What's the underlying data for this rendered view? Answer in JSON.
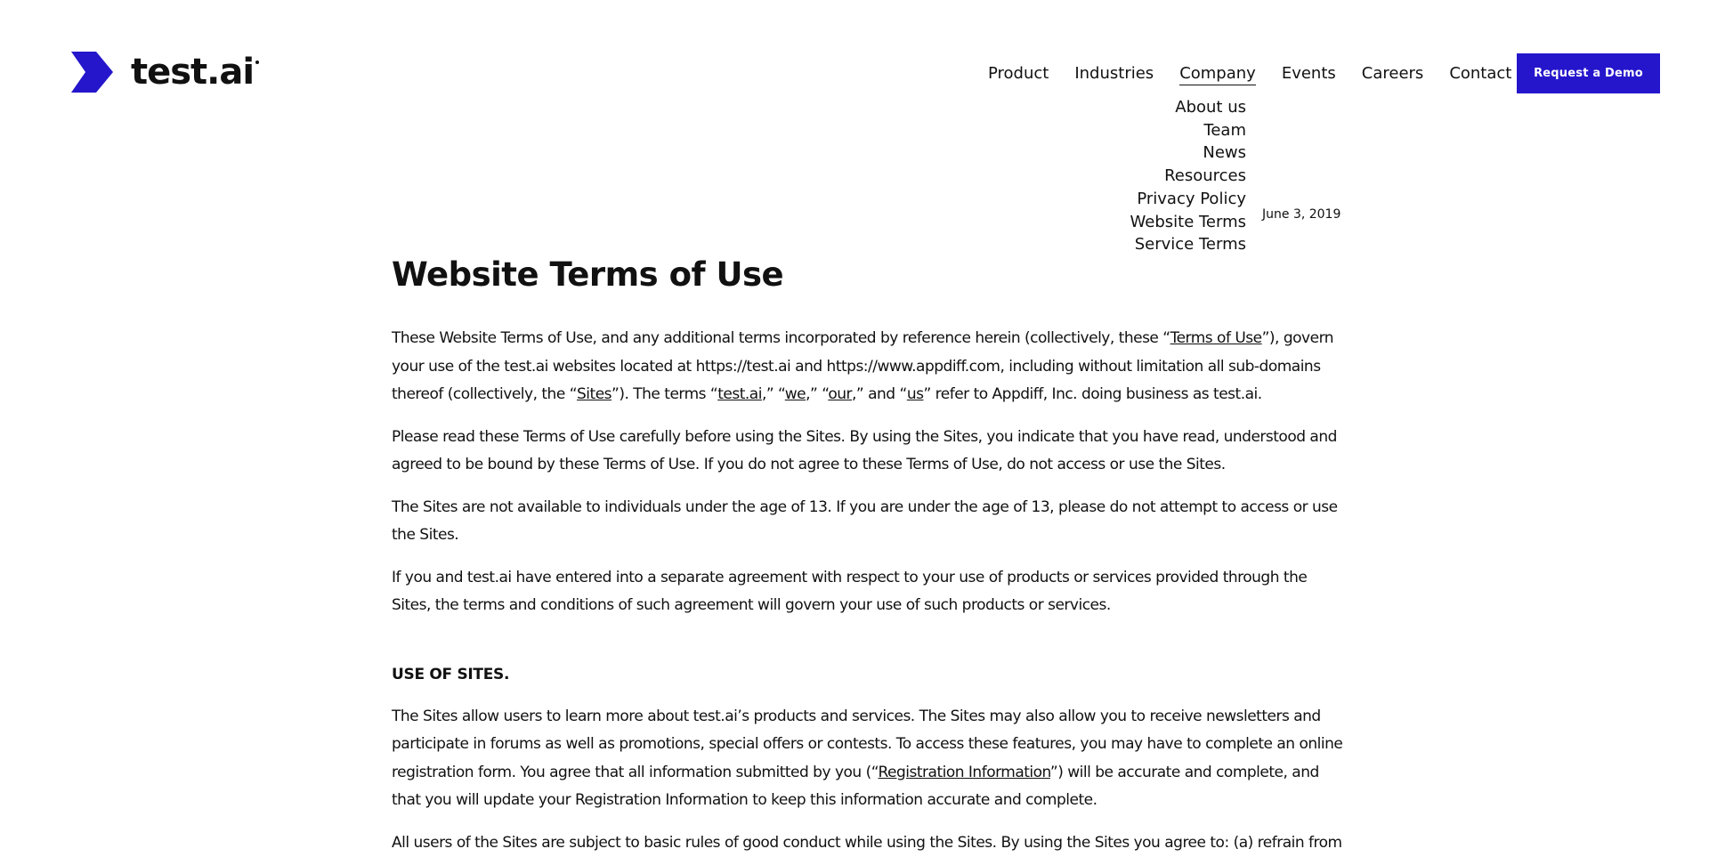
{
  "brand": {
    "name": "test.ai",
    "accent": "#2516cc"
  },
  "nav": {
    "items": [
      {
        "label": "Product"
      },
      {
        "label": "Industries"
      },
      {
        "label": "Company"
      },
      {
        "label": "Events"
      },
      {
        "label": "Careers"
      },
      {
        "label": "Contact"
      }
    ],
    "active": "Company",
    "cta_label": "Request a Demo"
  },
  "company_menu": {
    "items": [
      {
        "label": "About us"
      },
      {
        "label": "Team"
      },
      {
        "label": "News"
      },
      {
        "label": "Resources"
      },
      {
        "label": "Privacy Policy"
      },
      {
        "label": "Website Terms"
      },
      {
        "label": "Service Terms"
      }
    ]
  },
  "page": {
    "updated_date": "June 3, 2019",
    "title": "Website Terms of Use",
    "intro": {
      "p1": {
        "s1": "These Website Terms of Use, and any additional terms incorporated by reference herein (collectively, these “",
        "l1": "Terms of Use",
        "s2": "”), govern your use of the test.ai websites located at https://test.ai and https://www.appdiff.com, including without limitation all sub-domains thereof (collectively, the “",
        "l2": "Sites",
        "s3": "”).  The terms “",
        "l3": "test.ai",
        "s4": ",” “",
        "l4": "we",
        "s5": ",” “",
        "l5": "our",
        "s6": ",” and “",
        "l6": "us",
        "s7": "” refer to Appdiff, Inc. doing business as test.ai."
      },
      "p2": "Please read these Terms of Use carefully before using the Sites.  By using the Sites, you indicate that you have read, understood and agreed to be bound by these Terms of Use.  If you do not agree to these Terms of Use, do not access or use the Sites.",
      "p3": "The Sites are not available to individuals under the age of 13.  If you are under the age of 13, please do not attempt to access or use the Sites.",
      "p4": "If you and test.ai have entered into a separate agreement with respect to your use of products or services provided through the Sites, the terms and conditions of such agreement will govern your use of such products or services."
    },
    "section1": {
      "heading": "USE OF SITES.",
      "p1": {
        "s1": "The Sites allow users to learn more about test.ai’s products and services.  The Sites may also allow you to receive newsletters and participate in forums as well as promotions, special offers or contests.  To access these features, you may have to complete an online registration form.  You agree that all information submitted by you (“",
        "l1": "Registration Information",
        "s2": "”) will be accurate and complete, and that you will update your Registration Information to keep this information accurate and complete."
      },
      "p2": "All users of the Sites are subject to basic rules of good conduct while using the Sites.  By using the Sites you agree to: (a) refrain from"
    }
  }
}
